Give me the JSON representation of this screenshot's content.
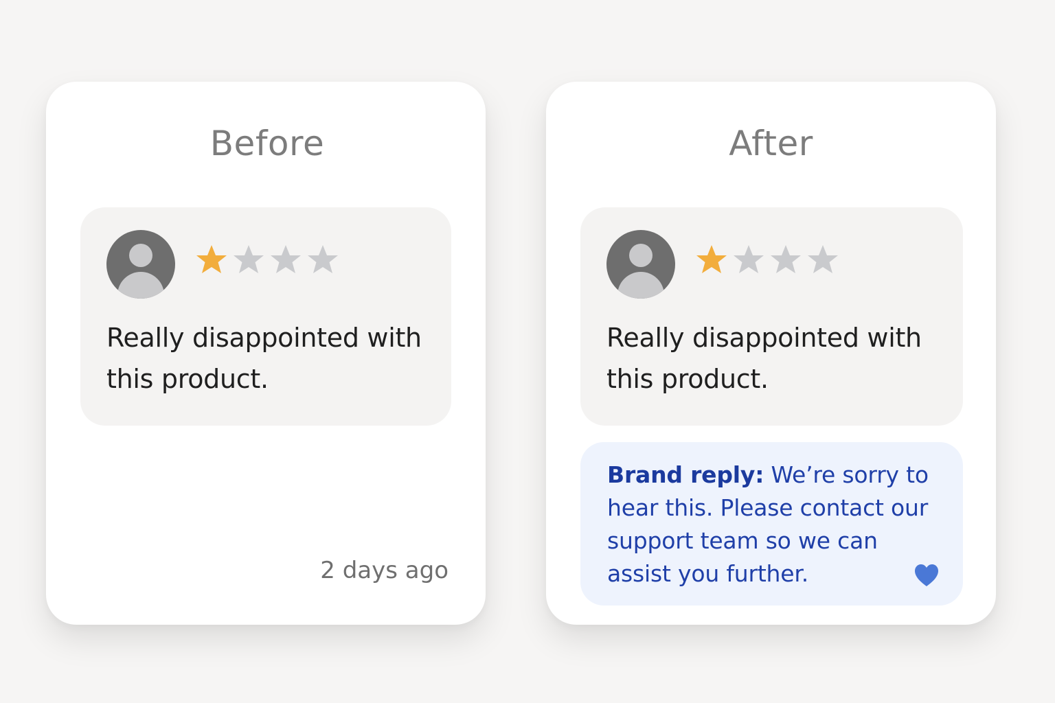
{
  "before": {
    "title": "Before",
    "review": {
      "rating": 1,
      "max_rating": 4,
      "text": "Really disappointed with this product."
    },
    "timestamp": "2 days ago"
  },
  "after": {
    "title": "After",
    "review": {
      "rating": 1,
      "max_rating": 4,
      "text": "Really disappointed with this product."
    },
    "reply": {
      "label": "Brand reply:",
      "text": "We’re sorry to hear this. Please contact our support team so we can assist you further.",
      "icon": "heart-icon"
    }
  },
  "colors": {
    "background": "#f6f5f4",
    "card": "#ffffff",
    "review_bubble": "#f4f3f2",
    "reply_bubble": "#eef3fd",
    "star_filled": "#f2ad3c",
    "star_empty": "#c9cacd",
    "avatar": "#6e6e6e",
    "reply_text": "#1f3fa8",
    "heart": "#4a78d6"
  }
}
